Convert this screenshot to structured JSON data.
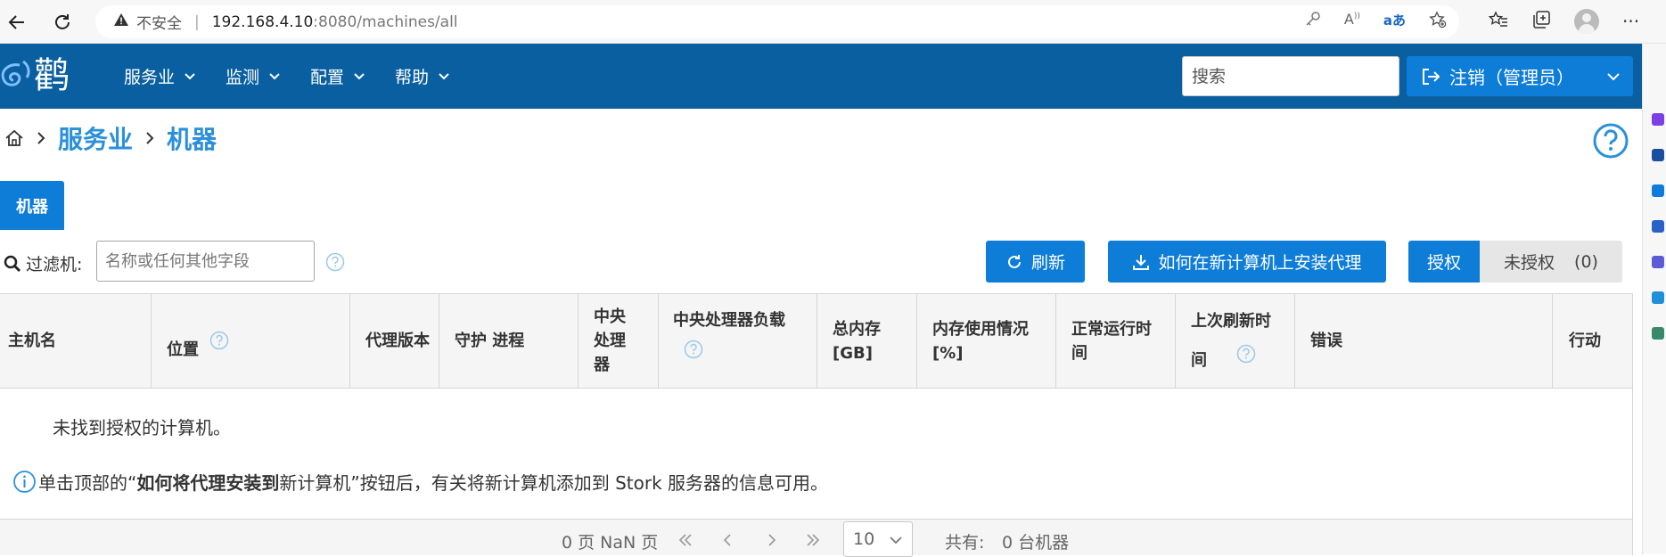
{
  "browser": {
    "insecure_label": "不安全",
    "url_host": "192.168.4.10",
    "url_path": ":8080/machines/all"
  },
  "app": {
    "logo_text": "鹳",
    "menu": [
      {
        "label": "服务业"
      },
      {
        "label": "监测"
      },
      {
        "label": "配置"
      },
      {
        "label": "帮助"
      }
    ],
    "search_placeholder": "搜索",
    "logout_label": "注销（管理员）"
  },
  "breadcrumb": {
    "items": [
      "服务业",
      "机器"
    ]
  },
  "tab": {
    "label": "机器"
  },
  "filter": {
    "label": "过滤机:",
    "placeholder": "名称或任何其他字段"
  },
  "actions": {
    "refresh_label": "刷新",
    "install_agent_label": "如何在新计算机上安装代理",
    "authorized_label": "授权",
    "unauthorized_label": "未授权",
    "unauthorized_count": "(0)"
  },
  "table": {
    "columns": [
      {
        "label": "主机名",
        "help": false
      },
      {
        "label": "位置",
        "help": true
      },
      {
        "label": "代理版本",
        "help": false
      },
      {
        "label": "守护 进程",
        "help": false
      },
      {
        "label": "中央处理器",
        "help": false
      },
      {
        "label": "中央处理器负载",
        "help": true
      },
      {
        "label": "总内存 [GB]",
        "help": false
      },
      {
        "label": "内存使用情况 [%]",
        "help": false
      },
      {
        "label": "正常运行时间",
        "help": false
      },
      {
        "label": "上次刷新时间",
        "help": true
      },
      {
        "label": "错误",
        "help": false
      },
      {
        "label": "行动",
        "help": false
      }
    ],
    "empty_message": "未找到授权的计算机。",
    "info_prefix": "单击顶部的“",
    "info_bold": "如何将代理安装到",
    "info_suffix": "新计算机”按钮后，有关将新计算机添加到 Stork 服务器的信息可用。"
  },
  "pager": {
    "page_report": "0 页 NaN 页",
    "rows_per_page": "10",
    "total_label": "共有:",
    "total_value": "0 台机器"
  },
  "colors": {
    "header_bg": "#0a5fa0",
    "primary": "#0e7dd8",
    "link": "#2b90d9"
  }
}
